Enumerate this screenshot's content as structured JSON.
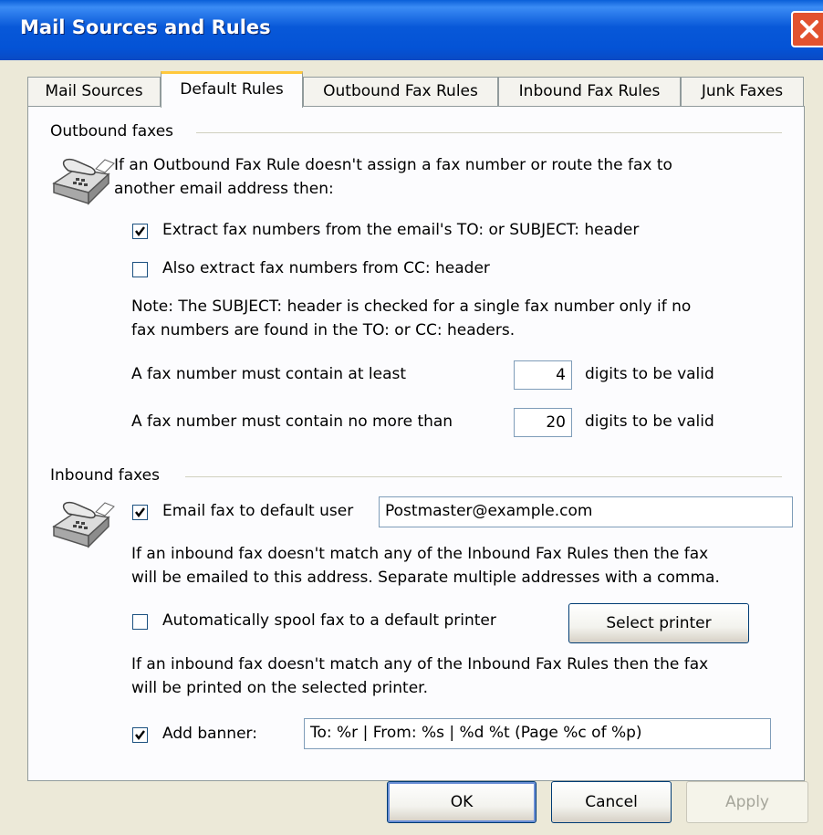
{
  "window": {
    "title": "Mail Sources and Rules"
  },
  "tabs": [
    {
      "label": "Mail Sources"
    },
    {
      "label": "Default Rules"
    },
    {
      "label": "Outbound Fax Rules"
    },
    {
      "label": "Inbound Fax Rules"
    },
    {
      "label": "Junk Faxes"
    }
  ],
  "outbound": {
    "group_label": "Outbound faxes",
    "intro_line1": "If an Outbound Fax Rule doesn't assign a fax number or route the fax to",
    "intro_line2": "another email address then:",
    "extract_to_subject": {
      "label": "Extract fax numbers from the email's TO: or SUBJECT: header",
      "checked": true
    },
    "extract_cc": {
      "label": "Also extract fax numbers from CC: header",
      "checked": false
    },
    "note_line1": "Note:  The SUBJECT: header is checked for a single fax number only if no",
    "note_line2": "fax numbers are found in the TO: or CC: headers.",
    "min_digits": {
      "label": "A fax number must contain at least",
      "value": "4",
      "suffix": "digits to be valid"
    },
    "max_digits": {
      "label": "A fax number must contain no more than",
      "value": "20",
      "suffix": "digits to be valid"
    }
  },
  "inbound": {
    "group_label": "Inbound faxes",
    "email_default": {
      "label": "Email fax to default user",
      "checked": true,
      "value": "Postmaster@example.com"
    },
    "email_note_line1": "If an inbound fax doesn't match any of the Inbound Fax Rules then the fax",
    "email_note_line2": "will be emailed to this address.  Separate multiple addresses with a comma.",
    "spool_printer": {
      "label": "Automatically spool fax to a default printer",
      "checked": false
    },
    "select_printer_label": "Select printer",
    "print_note_line1": "If an inbound fax doesn't match any of the Inbound Fax Rules then the fax",
    "print_note_line2": "will be printed on the selected printer.",
    "banner": {
      "label": "Add banner:",
      "checked": true,
      "value": "To: %r | From: %s | %d %t  (Page %c of %p)"
    }
  },
  "buttons": {
    "ok": "OK",
    "cancel": "Cancel",
    "apply": "Apply"
  },
  "icons": {
    "fax": "fax-machine-icon",
    "close": "close-icon",
    "check": "checkmark-icon"
  }
}
